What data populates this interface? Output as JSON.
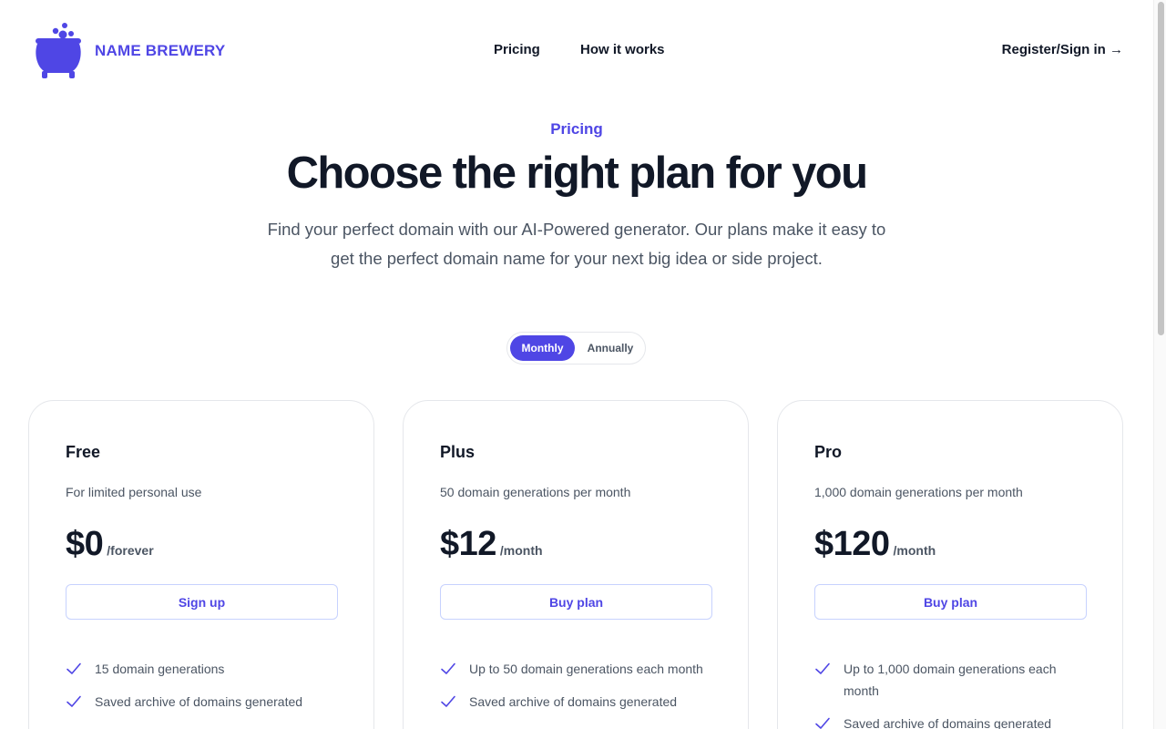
{
  "brand": {
    "name": "NAME BREWERY",
    "accent": "#4f46e5",
    "logo_icon": "cauldron-icon"
  },
  "nav": {
    "pricing": "Pricing",
    "how_it_works": "How it works",
    "register": "Register/Sign in →"
  },
  "hero": {
    "eyebrow": "Pricing",
    "title": "Choose the right plan for you",
    "subtitle": "Find your perfect domain with our AI-Powered generator. Our plans make it easy to get the perfect domain name for your next big idea or side project."
  },
  "billing_toggle": {
    "monthly": "Monthly",
    "annually": "Annually",
    "selected": "Monthly"
  },
  "plans": [
    {
      "name": "Free",
      "description": "For limited personal use",
      "price": "$0",
      "period": "/forever",
      "cta": "Sign up",
      "features": [
        "15 domain generations",
        "Saved archive of domains generated"
      ]
    },
    {
      "name": "Plus",
      "description": "50 domain generations per month",
      "price": "$12",
      "period": "/month",
      "cta": "Buy plan",
      "features": [
        "Up to 50 domain generations each month",
        "Saved archive of domains generated"
      ]
    },
    {
      "name": "Pro",
      "description": "1,000 domain generations per month",
      "price": "$120",
      "period": "/month",
      "cta": "Buy plan",
      "features": [
        "Up to 1,000 domain generations each month",
        "Saved archive of domains generated"
      ]
    }
  ],
  "icons": {
    "feature": "check-icon"
  }
}
